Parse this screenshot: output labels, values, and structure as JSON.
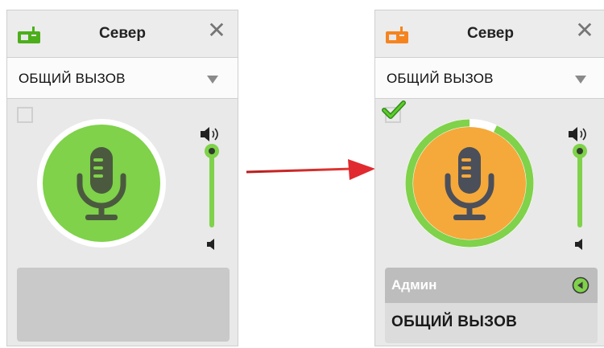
{
  "colors": {
    "idle_green": "#7fd24a",
    "talking_orange": "#f5a93a",
    "radio_icon_idle": "#4caf1a",
    "radio_icon_active": "#f5841f",
    "arrow_red": "#d8242a",
    "mic_dark": "#4b5a3f"
  },
  "icons": {
    "radio": "radio-device-icon",
    "close": "close-icon",
    "caret": "caret-down-icon",
    "mic": "microphone-icon",
    "speaker_loud": "speaker-loud-icon",
    "speaker_quiet": "speaker-quiet-icon",
    "check": "checkmark-icon",
    "play": "play-circle-icon",
    "arrow": "right-arrow-icon"
  },
  "panel_left": {
    "title": "Север",
    "close_label": "✕",
    "channel_select": "ОБЩИЙ ВЫЗОВ",
    "checkbox_checked": false,
    "volume_level": 1.0,
    "state": "idle"
  },
  "panel_right": {
    "title": "Север",
    "close_label": "✕",
    "channel_select": "ОБЩИЙ ВЫЗОВ",
    "checkbox_checked": true,
    "volume_level": 1.0,
    "transmit_progress": 0.93,
    "state": "talking",
    "caller_name": "Админ",
    "active_channel": "ОБЩИЙ ВЫЗОВ"
  }
}
